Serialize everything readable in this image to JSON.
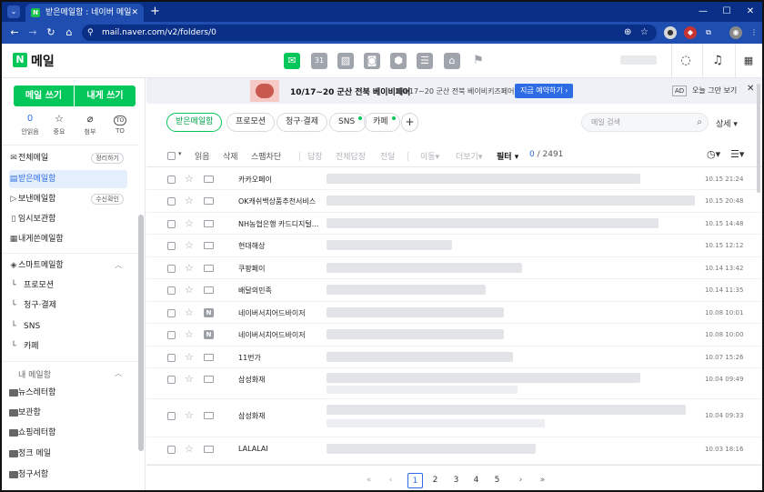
{
  "browser": {
    "tab_title": "받은메일함 : 네이버 메일",
    "favicon_letter": "N",
    "tab_close": "✕",
    "new_tab": "+",
    "url": "mail.naver.com/v2/folders/0"
  },
  "header": {
    "logo_letter": "N",
    "logo_text": "메일",
    "service_icons": [
      "mail-icon",
      "calendar-icon",
      "photo-icon",
      "contacts-icon",
      "mybox-icon",
      "memo-icon",
      "home-icon",
      "bookmark-icon"
    ]
  },
  "banner": {
    "title": "10/17~20 군산 전북 베이비페어",
    "subtitle": "10/17~20 군산 전북 베이비키즈페어",
    "button": "지금 예약하기 ›",
    "ad_badge": "AD",
    "dismiss": "오늘 그만 보기",
    "close": "✕"
  },
  "sidebar": {
    "compose": "메일 쓰기",
    "self_compose": "내게 쓰기",
    "quick": [
      {
        "value": "0",
        "label": "안읽음"
      },
      {
        "icon": "☆",
        "label": "중요"
      },
      {
        "icon": "⌀",
        "label": "첨부"
      },
      {
        "badge": "TO",
        "label": "TO"
      }
    ],
    "items": [
      {
        "label": "전체메일",
        "tag": "정리하기"
      },
      {
        "label": "받은메일함"
      },
      {
        "label": "보낸메일함",
        "tag": "수신확인"
      },
      {
        "label": "임시보관함"
      },
      {
        "label": "내게쓴메일함"
      },
      {
        "label": "스마트메일함"
      },
      {
        "label": "프로모션"
      },
      {
        "label": "청구·결제"
      },
      {
        "label": "SNS"
      },
      {
        "label": "카페"
      }
    ],
    "my_mailbox_header": "내 메일함",
    "folders": [
      "뉴스레터함",
      "보관함",
      "쇼핑레터함",
      "정크 메일",
      "청구서함"
    ]
  },
  "filters": {
    "chips": [
      "받은메일함",
      "프로모션",
      "청구·결제",
      "SNS",
      "카페"
    ],
    "plus": "+",
    "search_placeholder": "메일 검색",
    "detail": "상세 ▾"
  },
  "toolbar": {
    "read": "읽음",
    "delete": "삭제",
    "spam": "스팸차단",
    "reply": "답장",
    "reply_all": "전체답장",
    "forward": "전달",
    "move": "이동",
    "more": "더보기",
    "filter": "필터",
    "count_selected": "0",
    "count_total": "/ 2491"
  },
  "emails": [
    {
      "from": "카카오페이",
      "date": "10.15 21:24"
    },
    {
      "from": "OK캐쉬백상품추천서비스",
      "date": "10.15 20:48"
    },
    {
      "from": "NH농협은행 카드디지털...",
      "date": "10.15 14:48"
    },
    {
      "from": "현대해상",
      "date": "10.15 12:12"
    },
    {
      "from": "쿠팡페이",
      "date": "10.14 13:42"
    },
    {
      "from": "배달의민족",
      "date": "10.14 11:35"
    },
    {
      "from": "네이버서치어드바이저",
      "date": "10.08 10:01"
    },
    {
      "from": "네이버서치어드바이저",
      "date": "10.08 10:00"
    },
    {
      "from": "11번가",
      "date": "10.07 15:26"
    },
    {
      "from": "삼성화재",
      "date": "10.04 09:49"
    },
    {
      "from": "삼성화재",
      "date": "10.04 09:33"
    },
    {
      "from": "LALALAI",
      "date": "10.03 18:16"
    }
  ],
  "pager": {
    "first": "«",
    "prev": "‹",
    "pages": [
      "1",
      "2",
      "3",
      "4",
      "5"
    ],
    "next": "›",
    "last": "»"
  }
}
